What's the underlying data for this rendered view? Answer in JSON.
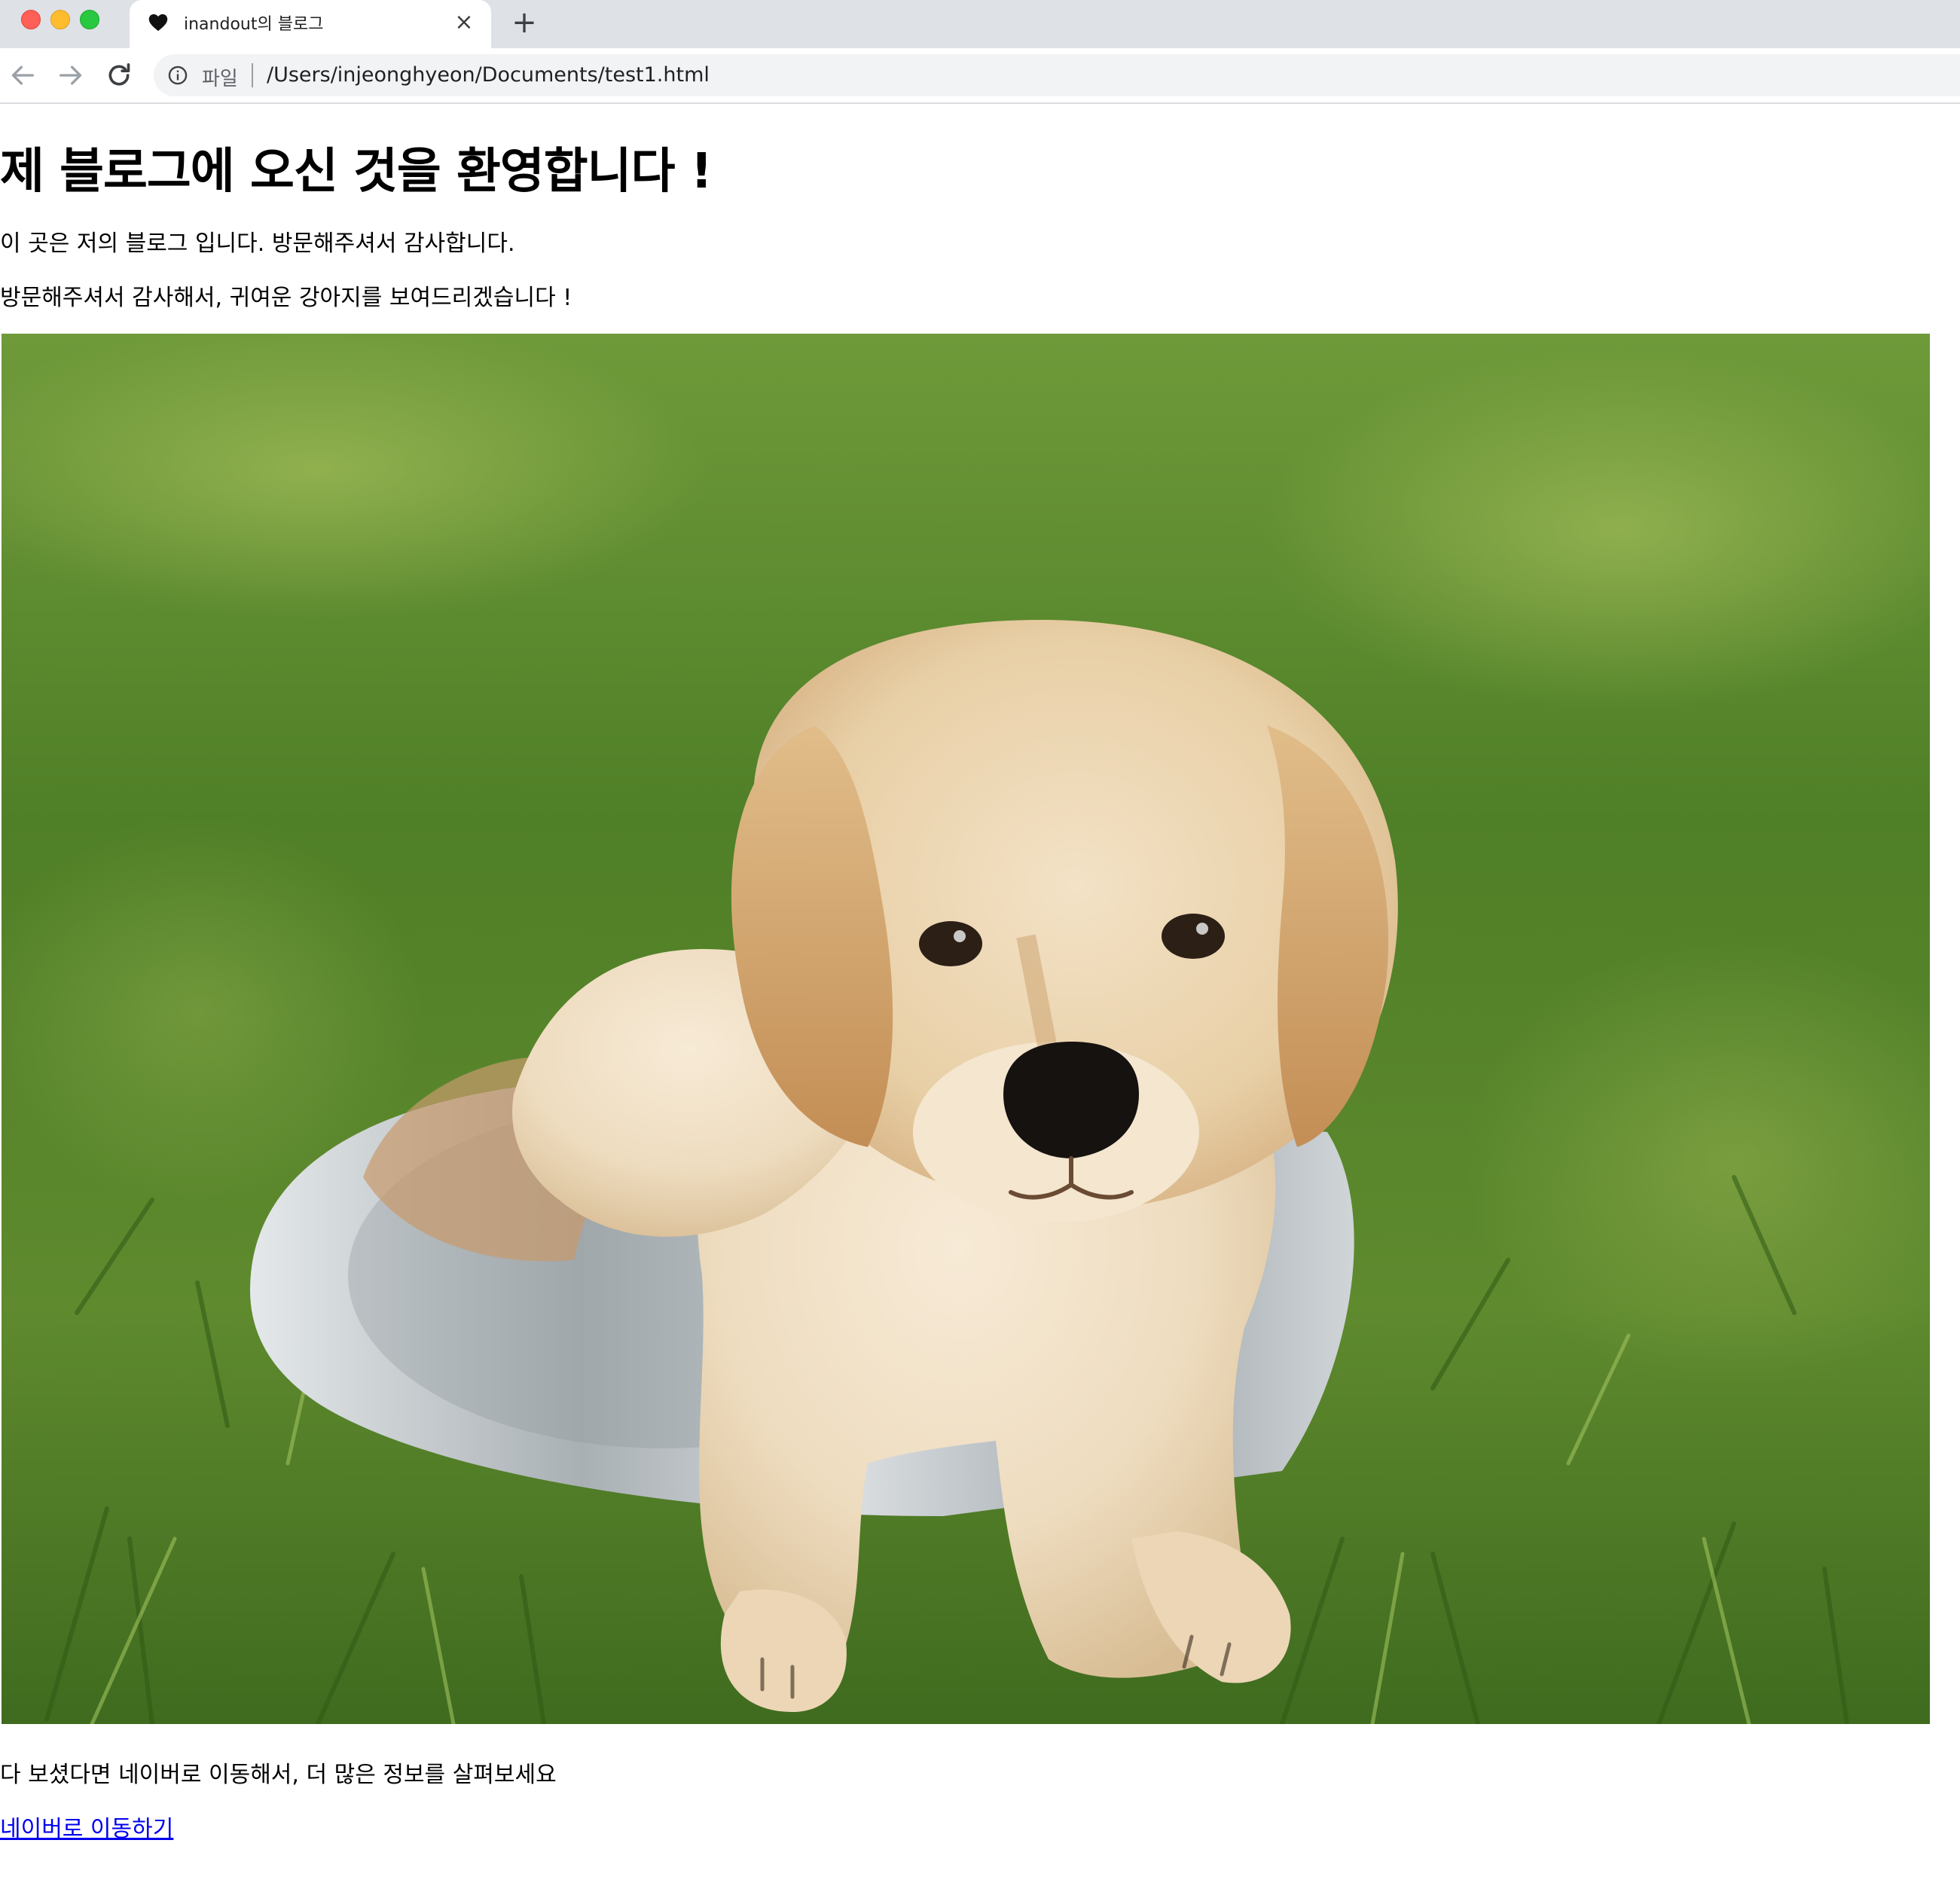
{
  "browser": {
    "tab": {
      "title": "inandout의 블로그",
      "favicon": "heart-icon"
    },
    "address_bar": {
      "scheme_label": "파일",
      "url": "/Users/injeonghyeon/Documents/test1.html"
    },
    "icons": {
      "back": "back-arrow-icon",
      "forward": "forward-arrow-icon",
      "reload": "reload-icon",
      "info": "info-icon",
      "close": "close-icon",
      "new_tab": "plus-icon"
    }
  },
  "page": {
    "heading": "제 블로그에 오신 것을 환영합니다 !",
    "intro": "이 곳은 저의 블로그 입니다. 방문해주셔서 감사합니다.",
    "thanks": "방문해주셔서 감사해서, 귀여운 강아지를 보여드리겠습니다 !",
    "image": {
      "subject": "golden retriever puppy sitting in a metal bowl on grass"
    },
    "outro": "다 보셨다면 네이버로 이동해서, 더 많은 정보를 살펴보세요",
    "link_text": "네이버로 이동하기"
  },
  "colors": {
    "link": "#0000ee",
    "tabbar": "#dee1e6",
    "omnibox": "#f1f3f4"
  }
}
